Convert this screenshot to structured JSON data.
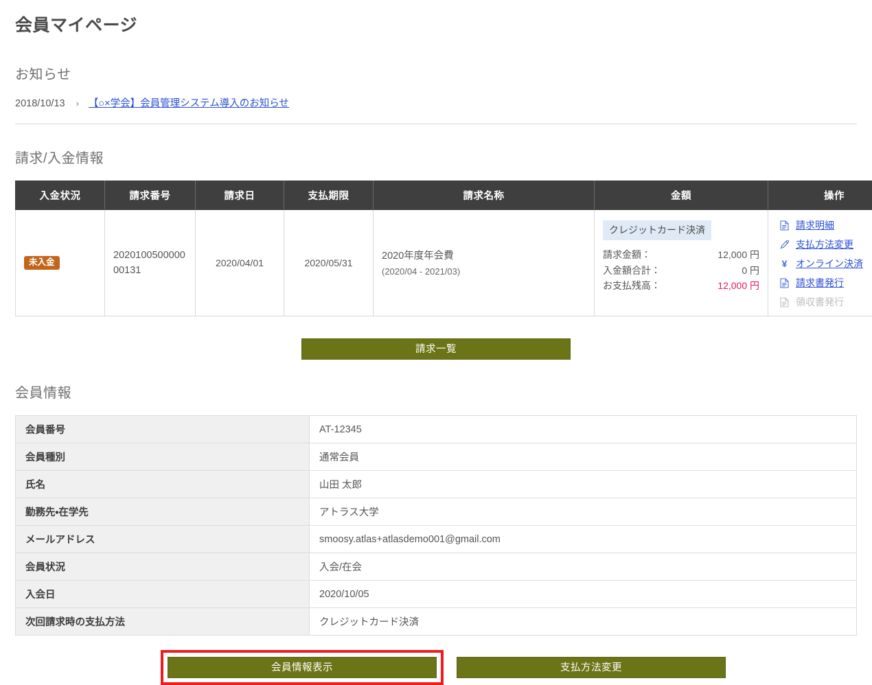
{
  "page": {
    "title": "会員マイページ"
  },
  "notice": {
    "heading": "お知らせ",
    "date": "2018/10/13",
    "separator": "›",
    "link_text": "【○×学会】会員管理システム導入のお知らせ"
  },
  "billing": {
    "heading": "請求/入金情報",
    "columns": [
      "入金状況",
      "請求番号",
      "請求日",
      "支払期限",
      "請求名称",
      "金額",
      "操作"
    ],
    "rows": [
      {
        "status_badge": "未入金",
        "invoice_number": "202010050000000131",
        "invoice_date": "2020/04/01",
        "due_date": "2020/05/31",
        "invoice_name": "2020年度年会費",
        "invoice_period": "(2020/04 - 2021/03)",
        "payment_method_badge": "クレジットカード決済",
        "amounts": [
          {
            "label": "請求金額：",
            "value": "12,000 円",
            "highlight": false
          },
          {
            "label": "入金額合計：",
            "value": "0 円",
            "highlight": false
          },
          {
            "label": "お支払残高：",
            "value": "12,000 円",
            "highlight": true
          }
        ],
        "actions": [
          {
            "label": "請求明細",
            "icon": "document-icon",
            "disabled": false
          },
          {
            "label": "支払方法変更",
            "icon": "pencil-icon",
            "disabled": false
          },
          {
            "label": "オンライン決済",
            "icon": "yen-icon",
            "disabled": false
          },
          {
            "label": "請求書発行",
            "icon": "document-icon",
            "disabled": false
          },
          {
            "label": "領収書発行",
            "icon": "document-icon",
            "disabled": true
          }
        ]
      }
    ],
    "list_button": "請求一覧"
  },
  "member": {
    "heading": "会員情報",
    "rows": [
      {
        "label": "会員番号",
        "value": "AT-12345"
      },
      {
        "label": "会員種別",
        "value": "通常会員"
      },
      {
        "label": "氏名",
        "value": "山田 太郎"
      },
      {
        "label": "勤務先・在学先",
        "value": "アトラス大学"
      },
      {
        "label": "メールアドレス",
        "value": "smoosy.atlas+atlasdemo001@gmail.com"
      },
      {
        "label": "会員状況",
        "value": "入会/在会"
      },
      {
        "label": "入会日",
        "value": "2020/10/05"
      },
      {
        "label": "次回請求時の支払方法",
        "value": "クレジットカード決済"
      }
    ]
  },
  "footer_buttons": {
    "member_info": "会員情報表示",
    "payment_change": "支払方法変更"
  },
  "colors": {
    "button_green": "#6b7416",
    "badge_unpaid": "#c2661b",
    "badge_payment": "#dfeaf6",
    "due_amount": "#e4195e",
    "link": "#2b50d6",
    "table_header": "#3f3f3f",
    "highlight_border": "#ee1c1c"
  }
}
